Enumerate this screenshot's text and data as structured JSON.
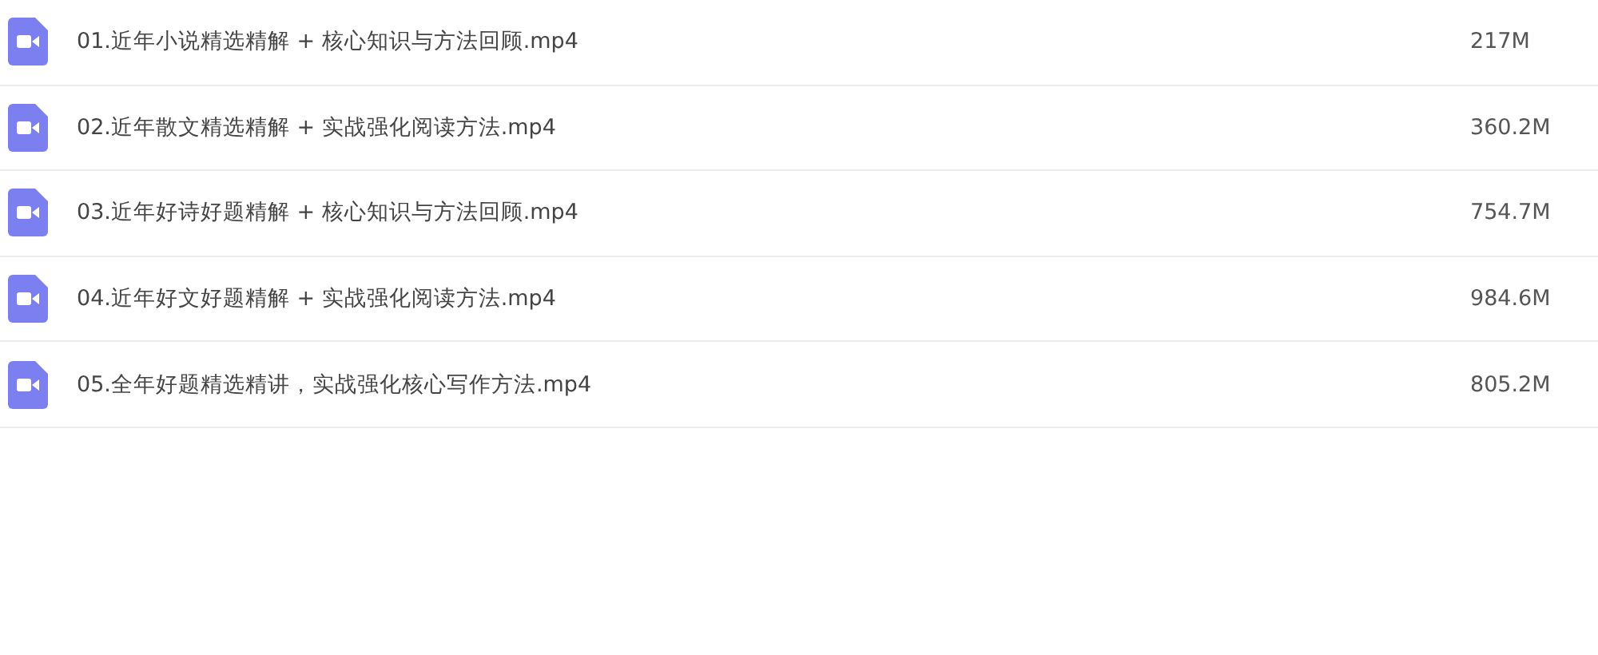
{
  "files": [
    {
      "name": "01.近年小说精选精解 + 核心知识与方法回顾.mp4",
      "size": "217M"
    },
    {
      "name": "02.近年散文精选精解 + 实战强化阅读方法.mp4",
      "size": "360.2M"
    },
    {
      "name": "03.近年好诗好题精解 + 核心知识与方法回顾.mp4",
      "size": "754.7M"
    },
    {
      "name": "04.近年好文好题精解 + 实战强化阅读方法.mp4",
      "size": "984.6M"
    },
    {
      "name": "05.全年好题精选精讲，实战强化核心写作方法.mp4",
      "size": "805.2M"
    }
  ]
}
